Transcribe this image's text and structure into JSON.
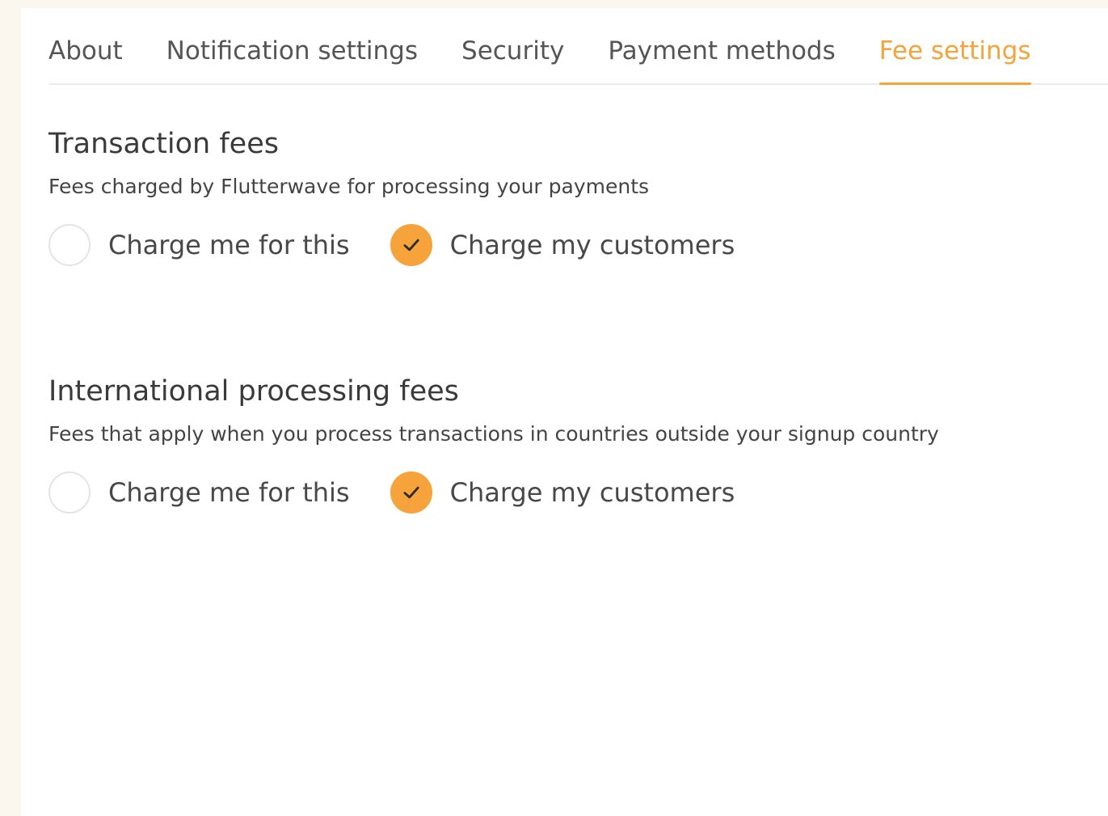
{
  "tabs": [
    {
      "label": "About",
      "active": false
    },
    {
      "label": "Notification settings",
      "active": false
    },
    {
      "label": "Security",
      "active": false
    },
    {
      "label": "Payment methods",
      "active": false
    },
    {
      "label": "Fee settings",
      "active": true
    }
  ],
  "sections": [
    {
      "title": "Transaction fees",
      "description": "Fees charged by Flutterwave for processing your payments",
      "options": [
        {
          "label": "Charge me for this",
          "selected": false
        },
        {
          "label": "Charge my customers",
          "selected": true
        }
      ]
    },
    {
      "title": "International processing fees",
      "description": "Fees that apply when you process transactions in countries outside your signup country",
      "options": [
        {
          "label": "Charge me for this",
          "selected": false
        },
        {
          "label": "Charge my customers",
          "selected": true
        }
      ]
    }
  ],
  "icons": {
    "selected": "check-icon"
  },
  "colors": {
    "accent": "#f5a33a",
    "background": "#fcf7ee"
  }
}
